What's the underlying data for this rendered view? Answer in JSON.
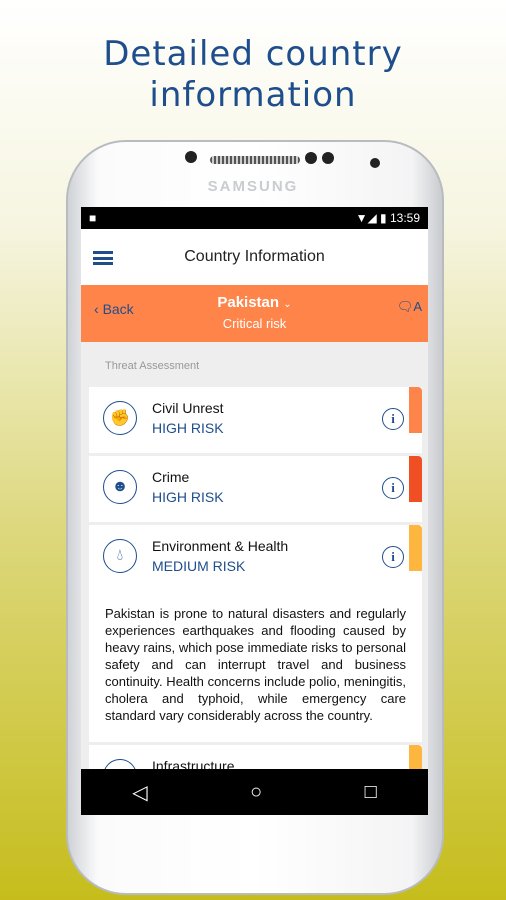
{
  "headline": [
    "Detailed country",
    "information"
  ],
  "device": {
    "brand": "SAMSUNG"
  },
  "status_bar": {
    "time": "13:59"
  },
  "app_bar": {
    "title": "Country Information"
  },
  "header": {
    "back_label": "Back",
    "country": "Pakistan",
    "risk_level": "Critical risk",
    "color": "#ff844a"
  },
  "section_title": "Threat Assessment",
  "threats": [
    {
      "name": "Civil Unrest",
      "level": "HIGH RISK",
      "icon": "fist-icon",
      "color": "#ff844a"
    },
    {
      "name": "Crime",
      "level": "HIGH RISK",
      "icon": "masked-face-icon",
      "color": "#f04e23"
    },
    {
      "name": "Environment & Health",
      "level": "MEDIUM RISK",
      "icon": "water-drop-icon",
      "color": "#ffb640",
      "description": "Pakistan is prone to natural disasters and regularly experiences earthquakes and flooding caused by heavy rains, which pose immediate risks to personal safety and can interrupt travel and business continuity. Health concerns include polio, meningitis, cholera and typhoid, while emergency care standard vary considerably across the country."
    },
    {
      "name": "Infrastructure",
      "color": "#ffb640"
    }
  ]
}
